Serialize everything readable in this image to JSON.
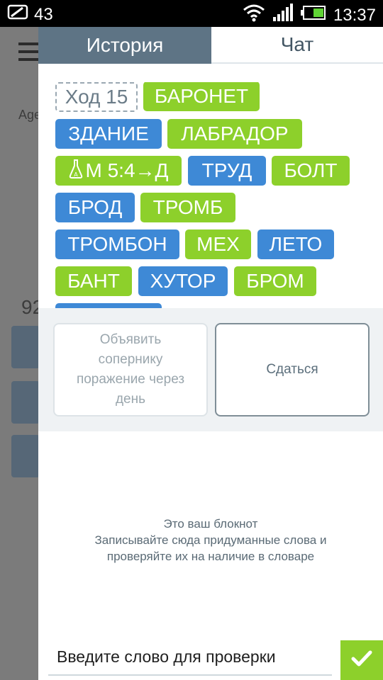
{
  "status_bar": {
    "notification_count": "43",
    "time": "13:37"
  },
  "background": {
    "age_label": "Age",
    "number": "92"
  },
  "tabs": [
    {
      "label": "История",
      "active": true
    },
    {
      "label": "Чат",
      "active": false
    }
  ],
  "words": [
    {
      "text": "Ход 15",
      "kind": "turn"
    },
    {
      "text": "БАРОНЕТ",
      "kind": "green"
    },
    {
      "text": "ЗДАНИЕ",
      "kind": "blue"
    },
    {
      "text": "ЛАБРАДОР",
      "kind": "green"
    },
    {
      "text": "М 5:4→Д",
      "kind": "green",
      "icon": "flask-icon"
    },
    {
      "text": "ТРУД",
      "kind": "blue"
    },
    {
      "text": "БОЛТ",
      "kind": "green"
    },
    {
      "text": "БРОД",
      "kind": "blue"
    },
    {
      "text": "ТРОМБ",
      "kind": "green"
    },
    {
      "text": "ТРОМБОН",
      "kind": "blue"
    },
    {
      "text": "МЕХ",
      "kind": "green"
    },
    {
      "text": "ЛЕТО",
      "kind": "blue"
    },
    {
      "text": "БАНТ",
      "kind": "green"
    },
    {
      "text": "ХУТОР",
      "kind": "blue"
    },
    {
      "text": "БРОМ",
      "kind": "green"
    }
  ],
  "actions": {
    "offer_label": "Объявить сопернику поражение через день",
    "surrender_label": "Сдаться"
  },
  "notepad": {
    "line1": "Это ваш блокнот",
    "line2": "Записывайте сюда придуманные слова и",
    "line3": "проверяйте их на наличие в словаре"
  },
  "input": {
    "placeholder": "Введите слово для проверки",
    "value": ""
  },
  "colors": {
    "green": "#8dd02b",
    "blue": "#3e89d6",
    "tab_active": "#5e7485"
  }
}
